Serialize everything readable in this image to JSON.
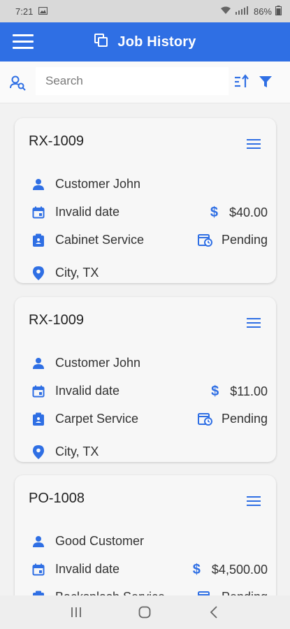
{
  "status_bar": {
    "time": "7:21",
    "battery": "86%"
  },
  "app_bar": {
    "title": "Job History"
  },
  "search": {
    "placeholder": "Search"
  },
  "colors": {
    "accent": "#2f6fe4",
    "app_bar": "#2f6fe4"
  },
  "jobs": [
    {
      "id": "RX-1009",
      "customer": "Customer John",
      "date": "Invalid date",
      "amount": "$40.00",
      "service": "Cabinet Service",
      "status": "Pending",
      "location": "City, TX"
    },
    {
      "id": "RX-1009",
      "customer": "Customer John",
      "date": "Invalid date",
      "amount": "$11.00",
      "service": "Carpet Service",
      "status": "Pending",
      "location": "City, TX"
    },
    {
      "id": "PO-1008",
      "customer": "Good Customer",
      "date": "Invalid date",
      "amount": "$4,500.00",
      "service": "Backsplash Service",
      "status": "Pending",
      "location": ""
    }
  ]
}
